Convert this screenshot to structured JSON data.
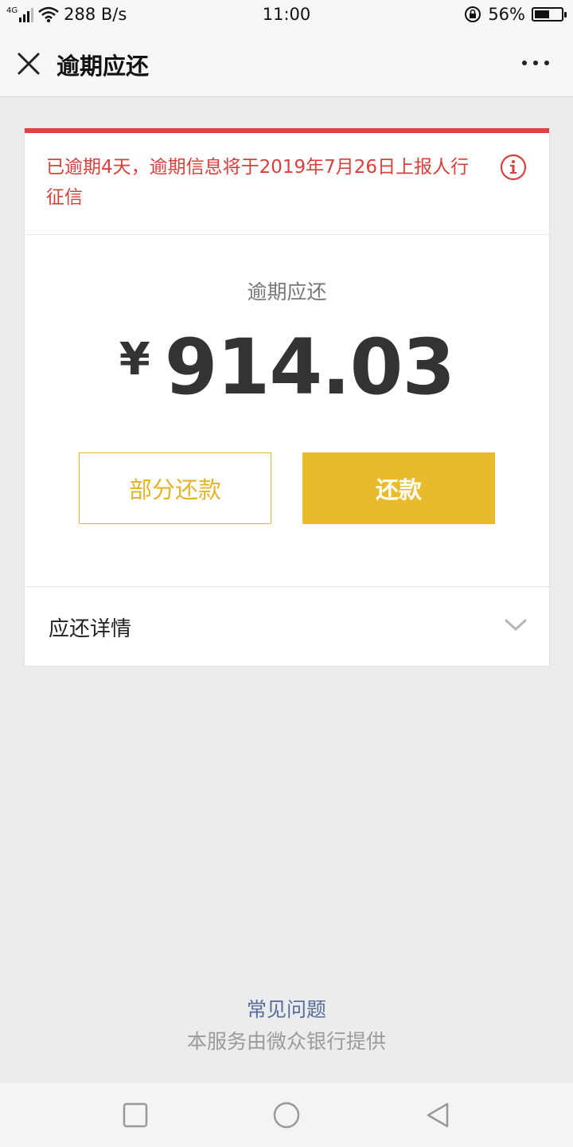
{
  "status_bar": {
    "network": "4G",
    "speed": "288 B/s",
    "time": "11:00",
    "battery_percent": "56%",
    "battery_level": 0.56
  },
  "nav": {
    "title": "逾期应还"
  },
  "warning": {
    "text": "已逾期4天，逾期信息将于2019年7月26日上报人行征信"
  },
  "amount": {
    "label": "逾期应还",
    "currency": "¥",
    "value": "914.03"
  },
  "buttons": {
    "partial": "部分还款",
    "repay": "还款"
  },
  "details": {
    "label": "应还详情"
  },
  "footer": {
    "faq": "常见问题",
    "provider": "本服务由微众银行提供"
  },
  "colors": {
    "warning_red": "#d9403c",
    "accent_yellow": "#e7bb2b",
    "link_blue": "#586d98"
  }
}
